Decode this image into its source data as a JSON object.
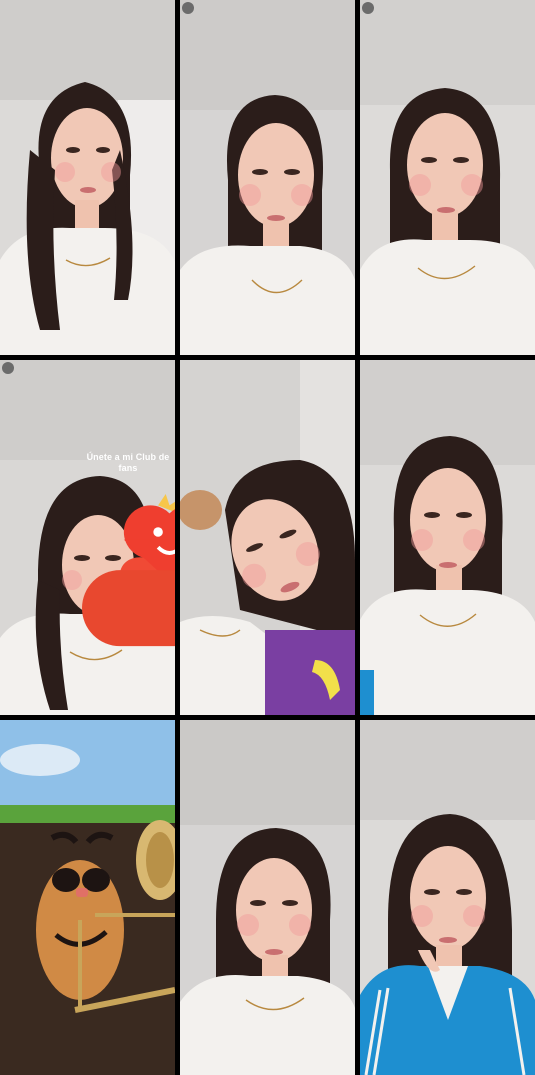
{
  "grid": {
    "columns": 3,
    "rows": 3,
    "tiles": [
      {
        "type": "person-portrait",
        "background": "wall",
        "shirt": "white"
      },
      {
        "type": "person-portrait",
        "background": "wall",
        "shirt": "white"
      },
      {
        "type": "person-portrait",
        "background": "wall",
        "shirt": "white"
      },
      {
        "type": "person-portrait",
        "background": "wall",
        "shirt": "white",
        "overlay": "fan-club-badge"
      },
      {
        "type": "person-portrait-tilted",
        "background": "wall",
        "shirt": "white"
      },
      {
        "type": "person-portrait",
        "background": "wall",
        "shirt": "white"
      },
      {
        "type": "potato-trombone-animation",
        "background": "soil-and-sky"
      },
      {
        "type": "person-portrait",
        "background": "wall",
        "shirt": "white"
      },
      {
        "type": "person-portrait",
        "background": "wall",
        "shirt": "blue-jacket"
      }
    ]
  },
  "fan_club_badge": {
    "line1": "Únete a mi Club de",
    "line2": "fans",
    "color": "#e8482f",
    "icon": "heart-mascot-icon"
  },
  "colors": {
    "wall": "#d9d7d5",
    "hair": "#2b1d1a",
    "skin": "#f1c8b6",
    "shirt": "#f3f1ee",
    "jacket": "#1e8fd0",
    "soil": "#3a2a20",
    "grass": "#5aa33c",
    "sky": "#8fc0e8",
    "potato": "#d08a45"
  }
}
